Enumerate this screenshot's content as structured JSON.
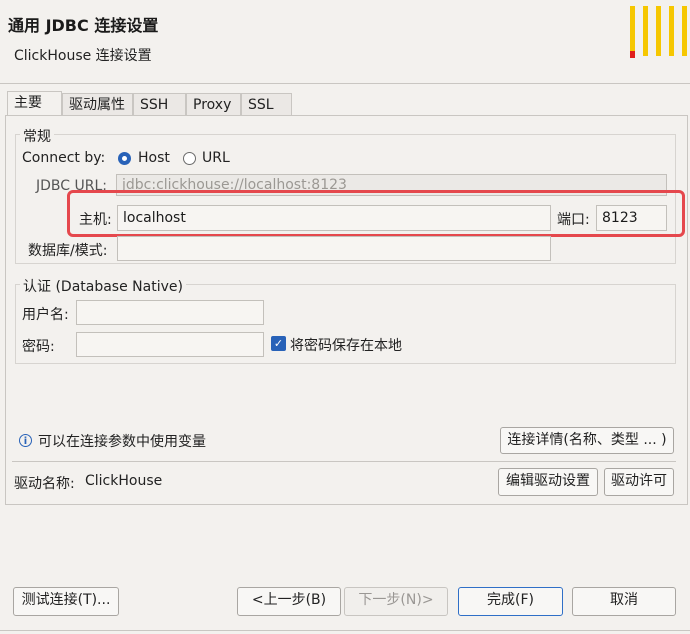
{
  "header": {
    "title": "通用 JDBC 连接设置",
    "subtitle": "ClickHouse 连接设置",
    "logo_icon": "clickhouse-logo"
  },
  "tabs": [
    {
      "label": "主要",
      "active": true
    },
    {
      "label": "驱动属性"
    },
    {
      "label": "SSH"
    },
    {
      "label": "Proxy"
    },
    {
      "label": "SSL"
    }
  ],
  "general": {
    "legend": "常规",
    "connect_by_label": "Connect by:",
    "host_option": "Host",
    "url_option": "URL",
    "selected": "Host",
    "jdbc_url_label": "JDBC URL:",
    "jdbc_url_value": "jdbc:clickhouse://localhost:8123",
    "host_label": "主机:",
    "host_value": "localhost",
    "port_label": "端口:",
    "port_value": "8123",
    "database_label": "数据库/模式:",
    "database_value": ""
  },
  "auth": {
    "legend": "认证 (Database Native)",
    "username_label": "用户名:",
    "username_value": "",
    "password_label": "密码:",
    "password_value": "",
    "save_password_label": "将密码保存在本地",
    "save_password_checked": true
  },
  "info": {
    "icon": "info-icon",
    "text": "可以在连接参数中使用变量",
    "details_button": "连接详情(名称、类型 ... )"
  },
  "driver": {
    "name_label": "驱动名称:",
    "name_value": "ClickHouse",
    "edit_button": "编辑驱动设置",
    "license_button": "驱动许可"
  },
  "footer": {
    "test_button": "测试连接(T)...",
    "back_button": "<上一步(B)",
    "next_button": "下一步(N)>",
    "finish_button": "完成(F)",
    "cancel_button": "取消"
  },
  "colors": {
    "accent": "#2862b8",
    "highlight": "#e5484d",
    "logo_yellow": "#f6c700",
    "logo_red": "#e0201c"
  }
}
